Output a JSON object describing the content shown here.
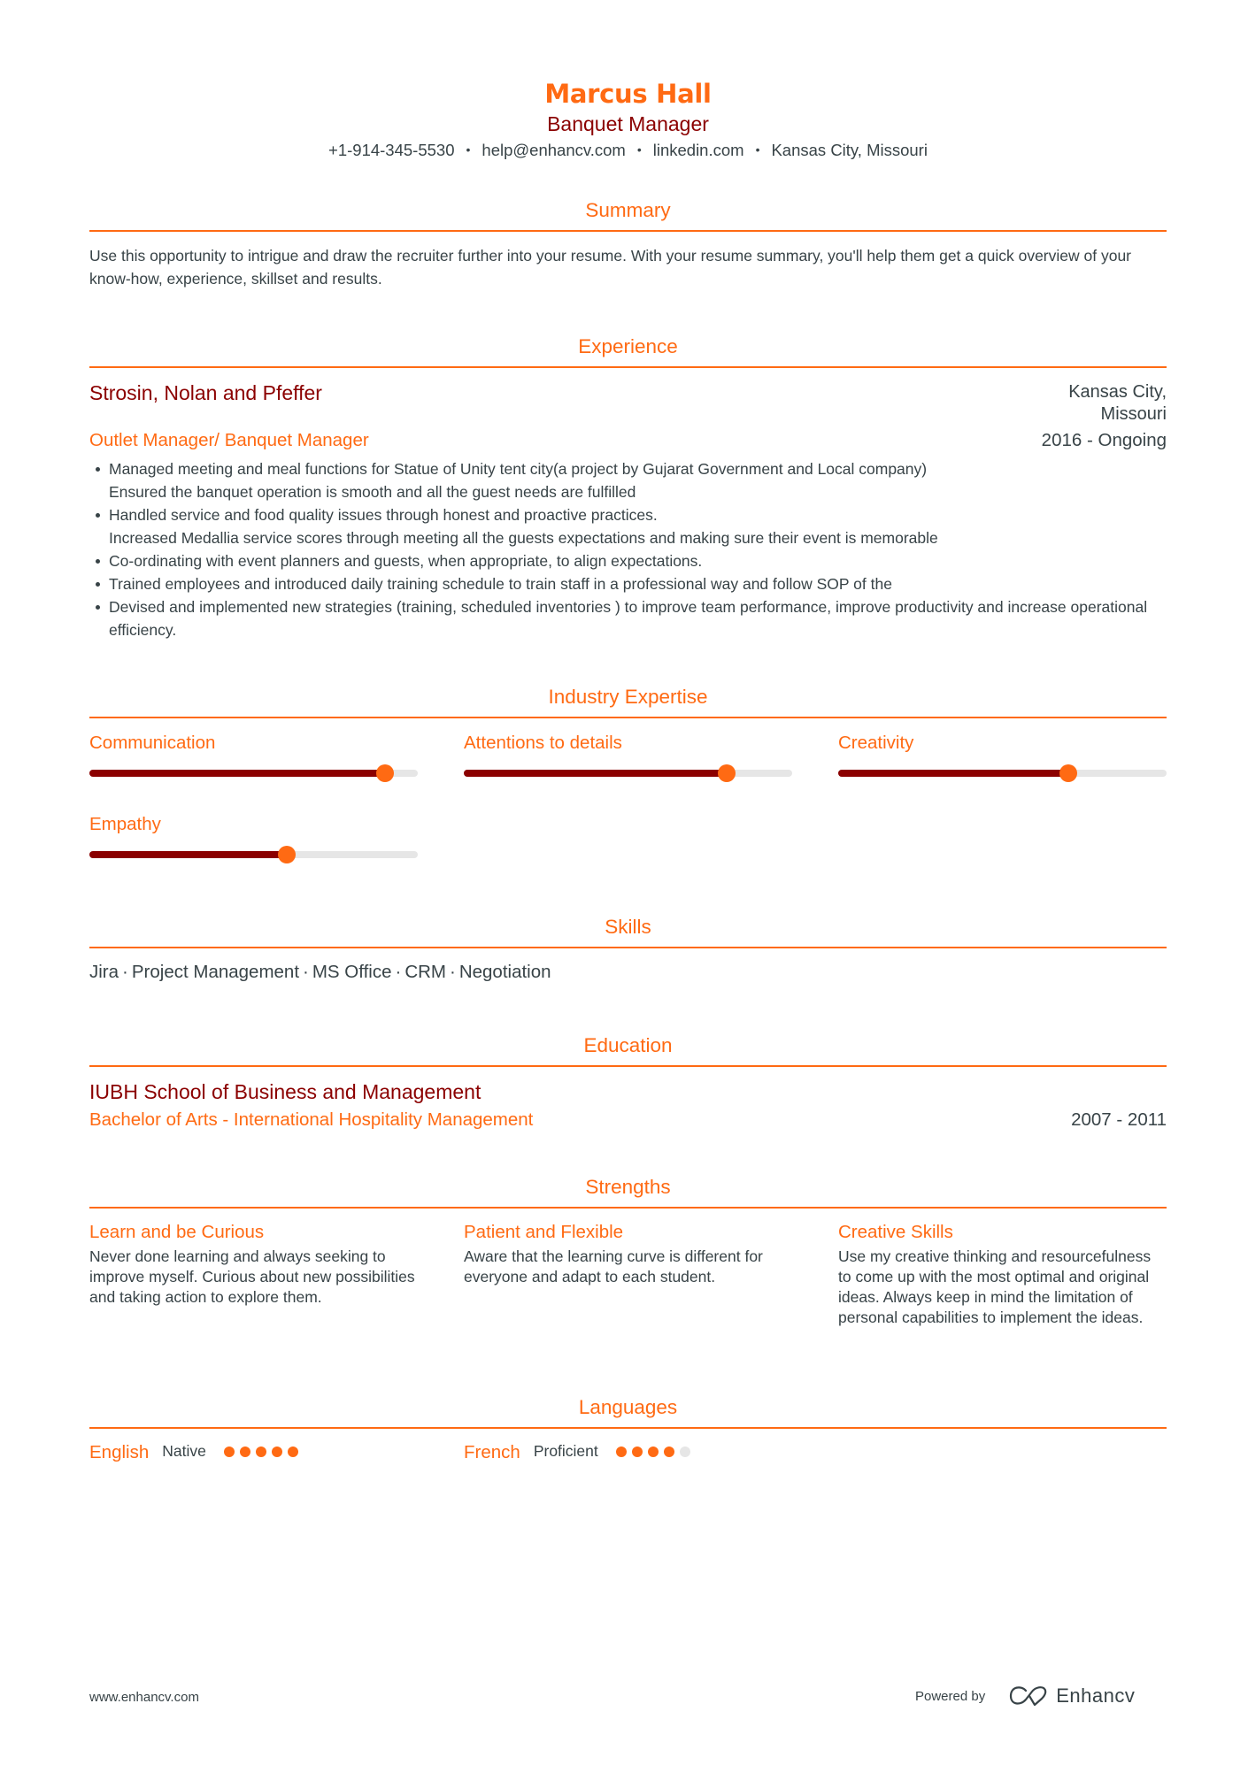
{
  "header": {
    "name": "Marcus Hall",
    "title": "Banquet Manager",
    "contact": {
      "phone": "+1-914-345-5530",
      "email": "help@enhancv.com",
      "linkedin": "linkedin.com",
      "location": "Kansas City, Missouri",
      "separator": "•"
    }
  },
  "colors": {
    "accent": "#ff6a13",
    "dark_accent": "#8b0000",
    "text": "#384347",
    "track": "#e6e6e6"
  },
  "sections": {
    "summary": "Summary",
    "experience": "Experience",
    "expertise": "Industry Expertise",
    "skills": "Skills",
    "education": "Education",
    "strengths": "Strengths",
    "languages": "Languages"
  },
  "summary": {
    "text": "Use this opportunity to intrigue and draw the recruiter further into your resume. With your resume summary, you'll help them get a quick overview of your know-how, experience, skillset and results."
  },
  "experience": [
    {
      "company": "Strosin, Nolan and Pfeffer",
      "location_line1": "Kansas City,",
      "location_line2": "Missouri",
      "role": "Outlet Manager/ Banquet Manager",
      "dates": "2016 - Ongoing",
      "bullets": [
        {
          "text": "Managed meeting and meal functions for Statue of Unity tent city(a project by Gujarat Government and Local company)",
          "continuation": "Ensured the banquet operation is smooth and all the guest needs are fulfilled"
        },
        {
          "text": "Handled service and food quality issues through honest and proactive practices.",
          "continuation": "Increased Medallia service scores through meeting all the guests expectations and making sure their event is memorable"
        },
        {
          "text": "Co-ordinating with event planners and guests, when appropriate, to align expectations.",
          "continuation": ""
        },
        {
          "text": "Trained employees and introduced daily training schedule to train staff in a professional way and follow SOP of the",
          "continuation": ""
        },
        {
          "text": "Devised and implemented new strategies (training, scheduled inventories ) to improve team performance, improve productivity and increase operational efficiency.",
          "continuation": ""
        }
      ]
    }
  ],
  "expertise": [
    {
      "label": "Communication",
      "level": 0.9
    },
    {
      "label": "Attentions to details",
      "level": 0.8
    },
    {
      "label": "Creativity",
      "level": 0.7
    },
    {
      "label": "Empathy",
      "level": 0.6
    }
  ],
  "skills": [
    "Jira",
    "Project Management",
    "MS Office",
    "CRM",
    "Negotiation"
  ],
  "skills_separator": "·",
  "education": [
    {
      "school": "IUBH School of Business and Management",
      "degree": "Bachelor of Arts - International Hospitality Management",
      "dates": "2007 - 2011"
    }
  ],
  "strengths": [
    {
      "title": "Learn and be Curious",
      "description": "Never done learning and always seeking to improve myself. Curious about new possibilities and taking action to explore them."
    },
    {
      "title": "Patient and Flexible",
      "description": "Aware that the learning curve is different for everyone and adapt to each student."
    },
    {
      "title": "Creative Skills",
      "description": "Use my creative thinking and resourcefulness to come up with the most optimal and original ideas. Always keep in mind the limitation of personal capabilities to implement the ideas."
    }
  ],
  "languages": [
    {
      "name": "English",
      "level": "Native",
      "dots": 5,
      "max_dots": 5
    },
    {
      "name": "French",
      "level": "Proficient",
      "dots": 4,
      "max_dots": 5
    }
  ],
  "footer": {
    "website": "www.enhancv.com",
    "powered_by": "Powered by",
    "brand": "Enhancv",
    "logo_icon": "enhancv-logo-icon"
  }
}
